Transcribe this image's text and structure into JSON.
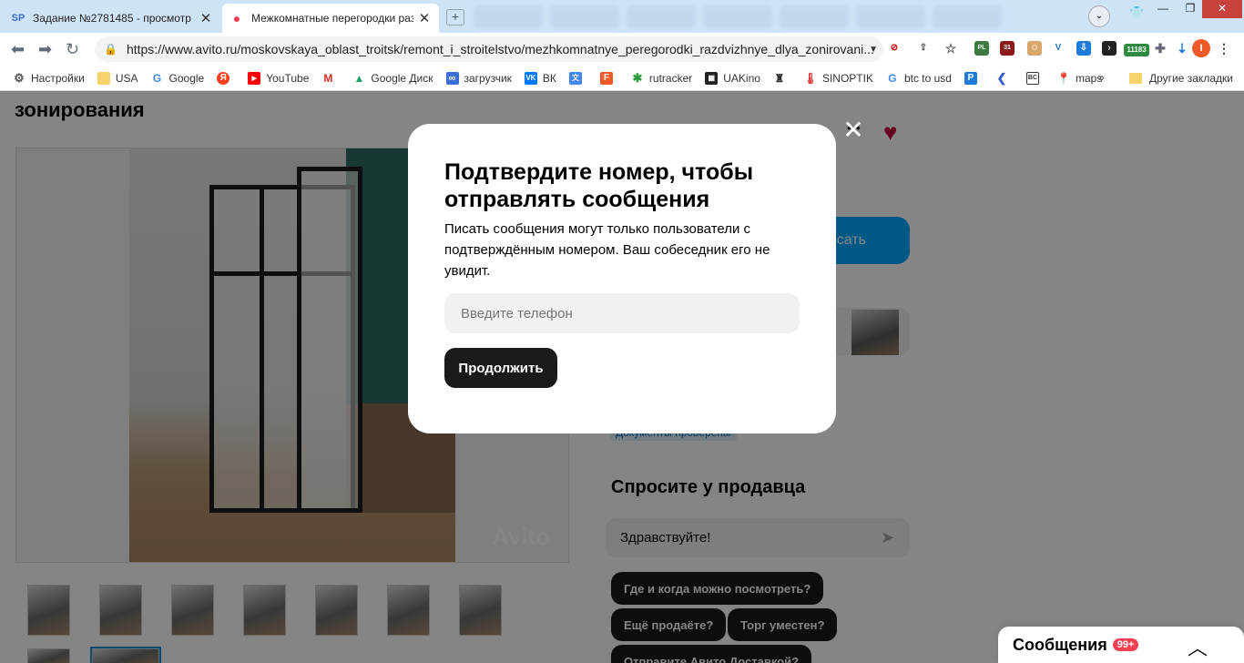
{
  "browser": {
    "tabs": [
      {
        "favicon": "SP",
        "title": "Задание №2781485 - просмотр з"
      },
      {
        "favicon": "●",
        "title": "Межкомнатные перегородки раз"
      }
    ],
    "new_tab": "+",
    "window": {
      "minimize": "—",
      "maximize": "❐",
      "close": "✕"
    },
    "url": "https://www.avito.ru/moskovskaya_oblast_troitsk/remont_i_stroitelstvo/mezhkomnatnye_peregorodki_razdvizhnye_dlya_zonirovani...",
    "extension_badge": "11183",
    "extension_labels": [
      "PL",
      "31"
    ],
    "bookmarks": [
      {
        "icon": "gear-icon",
        "label": "Настройки"
      },
      {
        "icon": "folder-icon",
        "label": "USA"
      },
      {
        "icon": "google-icon",
        "label": "Google"
      },
      {
        "icon": "yandex-icon",
        "label": ""
      },
      {
        "icon": "youtube-icon",
        "label": "YouTube"
      },
      {
        "icon": "gmail-icon",
        "label": ""
      },
      {
        "icon": "drive-icon",
        "label": "Google Диск"
      },
      {
        "icon": "infinity-icon",
        "label": "загрузчик"
      },
      {
        "icon": "vk-icon",
        "label": "ВК"
      },
      {
        "icon": "translate-icon",
        "label": ""
      },
      {
        "icon": "f-icon",
        "label": ""
      },
      {
        "icon": "star-icon",
        "label": "rutracker"
      },
      {
        "icon": "film-icon",
        "label": "UAKino"
      },
      {
        "icon": "bottle-icon",
        "label": ""
      },
      {
        "icon": "thermometer-icon",
        "label": "SINOPTIK"
      },
      {
        "icon": "google-icon",
        "label": "btc to usd"
      },
      {
        "icon": "p-icon",
        "label": ""
      },
      {
        "icon": "arrow-icon",
        "label": ""
      },
      {
        "icon": "bc-icon",
        "label": ""
      },
      {
        "icon": "maps-icon",
        "label": "maps"
      }
    ],
    "bookmarks_more": "»",
    "other_bookmarks": "Другие закладки"
  },
  "page": {
    "title_fragment": "зонирования",
    "watermark": "Avito",
    "write_button_fragment": "сать",
    "docs_badge": "Документы проверены",
    "ask_title": "Спросите у продавца",
    "ask_input_value": "Здравствуйте!",
    "chips": [
      "Где и когда можно посмотреть?",
      "Ещё продаёте?",
      "Торг уместен?",
      "Отправите Авито Доставкой?"
    ],
    "messages": {
      "label": "Сообщения",
      "badge": "99+"
    }
  },
  "modal": {
    "title": "Подтвердите номер, чтобы отправлять сообщения",
    "text": "Писать сообщения могут только пользователи с подтверждённым номером. Ваш собеседник его не увидит.",
    "phone_placeholder": "Введите телефон",
    "phone_value": "",
    "continue_label": "Продолжить"
  },
  "colors": {
    "accent_blue": "#00aaff",
    "dark_button": "#1a1a1a",
    "favorite_heart": "#c0003a",
    "badge_red": "#ff4053"
  }
}
